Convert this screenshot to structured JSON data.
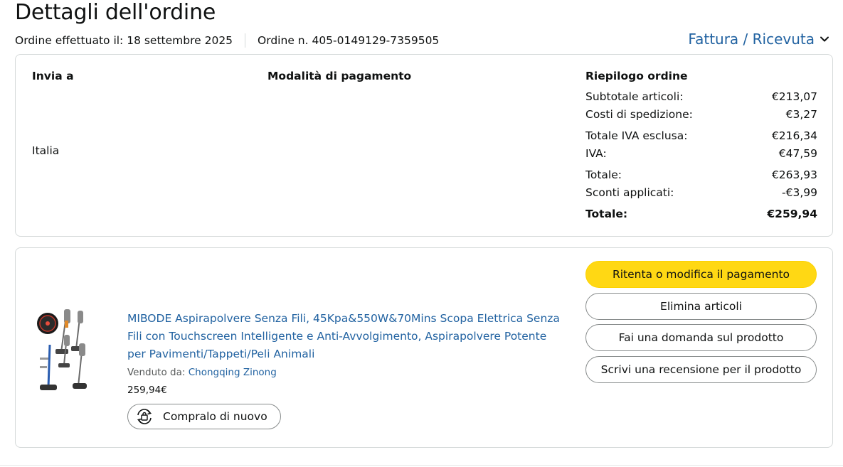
{
  "header": {
    "title": "Dettagli dell'ordine",
    "order_date": "Ordine effettuato il: 18 settembre 2025",
    "order_number": "Ordine n. 405-0149129-7359505",
    "invoice_label": "Fattura / Ricevuta"
  },
  "shipping": {
    "title": "Invia a",
    "country": "Italia"
  },
  "payment": {
    "title": "Modalità di pagamento"
  },
  "summary": {
    "title": "Riepilogo ordine",
    "rows": [
      {
        "label": "Subtotale articoli:",
        "value": "€213,07"
      },
      {
        "label": "Costi di spedizione:",
        "value": "€3,27"
      },
      {
        "label": "Totale IVA esclusa:",
        "value": "€216,34"
      },
      {
        "label": "IVA:",
        "value": "€47,59"
      },
      {
        "label": "Totale:",
        "value": "€263,93"
      },
      {
        "label": "Sconti applicati:",
        "value": "-€3,99"
      },
      {
        "label": "Totale:",
        "value": "€259,94"
      }
    ]
  },
  "item": {
    "title": "MIBODE Aspirapolvere Senza Fili, 45Kpa&550W&70Mins Scopa Elettrica Senza Fili con Touchscreen Intelligente e Anti-Avvolgimento, Aspirapolvere Potente per Pavimenti/Tappeti/Peli Animali",
    "sold_by_label": "Venduto da:",
    "seller": "Chongqing Zinong",
    "price": "259,94€",
    "buy_again_label": "Compralo di nuovo"
  },
  "actions": {
    "retry_payment": "Ritenta o modifica il pagamento",
    "delete_items": "Elimina articoli",
    "ask_question": "Fai una domanda sul prodotto",
    "write_review": "Scrivi una recensione per il prodotto"
  },
  "colors": {
    "link": "#2162a1",
    "primary_button": "#ffd814",
    "border": "#d5d9d9"
  }
}
